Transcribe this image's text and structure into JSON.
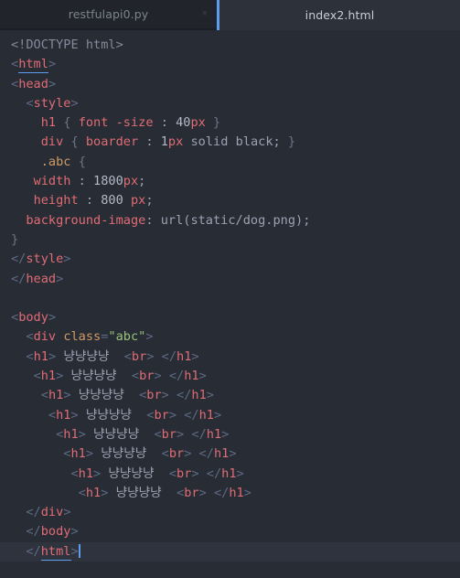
{
  "window": {
    "theme_background": "#282c34",
    "accent_color": "#5c9ded"
  },
  "tabs": [
    {
      "label": "restfulapi0.py",
      "active": false,
      "close_glyph": "×"
    },
    {
      "label": "index2.html",
      "active": true
    }
  ],
  "editor": {
    "language": "html",
    "current_line_index": 31,
    "code_lines": [
      {
        "indent": "",
        "segments": [
          {
            "text": "<!DOCTYPE html>",
            "cls": "dctp"
          }
        ]
      },
      {
        "indent": "",
        "segments": [
          {
            "text": "<",
            "cls": "pnc"
          },
          {
            "text": "html",
            "cls": "tag underline-tag"
          },
          {
            "text": ">",
            "cls": "pnc"
          }
        ]
      },
      {
        "indent": "",
        "segments": [
          {
            "text": "<",
            "cls": "pnc"
          },
          {
            "text": "head",
            "cls": "tag"
          },
          {
            "text": ">",
            "cls": "pnc"
          }
        ]
      },
      {
        "indent": "  ",
        "segments": [
          {
            "text": "<",
            "cls": "pnc"
          },
          {
            "text": "style",
            "cls": "tag"
          },
          {
            "text": ">",
            "cls": "pnc"
          }
        ]
      },
      {
        "indent": "    ",
        "segments": [
          {
            "text": "h1",
            "cls": "tag"
          },
          {
            "text": " ",
            "cls": "txt"
          },
          {
            "text": "{",
            "cls": "brace"
          },
          {
            "text": " ",
            "cls": "txt"
          },
          {
            "text": "font",
            "cls": "tag"
          },
          {
            "text": " ",
            "cls": "txt"
          },
          {
            "text": "-size",
            "cls": "tag"
          },
          {
            "text": " ",
            "cls": "txt"
          },
          {
            "text": ":",
            "cls": "txt"
          },
          {
            "text": " ",
            "cls": "txt"
          },
          {
            "text": "40",
            "cls": "num"
          },
          {
            "text": "px",
            "cls": "unit"
          },
          {
            "text": " ",
            "cls": "txt"
          },
          {
            "text": "}",
            "cls": "brace"
          }
        ]
      },
      {
        "indent": "    ",
        "segments": [
          {
            "text": "div",
            "cls": "tag"
          },
          {
            "text": " ",
            "cls": "txt"
          },
          {
            "text": "{",
            "cls": "brace"
          },
          {
            "text": " ",
            "cls": "txt"
          },
          {
            "text": "boarder",
            "cls": "tag"
          },
          {
            "text": " ",
            "cls": "txt"
          },
          {
            "text": ":",
            "cls": "txt"
          },
          {
            "text": " ",
            "cls": "txt"
          },
          {
            "text": "1",
            "cls": "num"
          },
          {
            "text": "px",
            "cls": "unit"
          },
          {
            "text": " ",
            "cls": "txt"
          },
          {
            "text": "solid",
            "cls": "txt"
          },
          {
            "text": " ",
            "cls": "txt"
          },
          {
            "text": "black",
            "cls": "txt"
          },
          {
            "text": ";",
            "cls": "txt"
          },
          {
            "text": " ",
            "cls": "txt"
          },
          {
            "text": "}",
            "cls": "brace"
          }
        ]
      },
      {
        "indent": "    ",
        "segments": [
          {
            "text": ".abc",
            "cls": "attr"
          },
          {
            "text": " ",
            "cls": "txt"
          },
          {
            "text": "{",
            "cls": "brace"
          }
        ]
      },
      {
        "indent": "   ",
        "segments": [
          {
            "text": "width",
            "cls": "tag"
          },
          {
            "text": " ",
            "cls": "txt"
          },
          {
            "text": ":",
            "cls": "txt"
          },
          {
            "text": " ",
            "cls": "txt"
          },
          {
            "text": "1800",
            "cls": "num"
          },
          {
            "text": "px",
            "cls": "unit"
          },
          {
            "text": ";",
            "cls": "txt"
          }
        ]
      },
      {
        "indent": "   ",
        "segments": [
          {
            "text": "height",
            "cls": "tag"
          },
          {
            "text": " ",
            "cls": "txt"
          },
          {
            "text": ":",
            "cls": "txt"
          },
          {
            "text": " ",
            "cls": "txt"
          },
          {
            "text": "800",
            "cls": "num"
          },
          {
            "text": " ",
            "cls": "txt"
          },
          {
            "text": "px",
            "cls": "unit"
          },
          {
            "text": ";",
            "cls": "txt"
          }
        ]
      },
      {
        "indent": "  ",
        "segments": [
          {
            "text": "background-image",
            "cls": "tag"
          },
          {
            "text": ":",
            "cls": "txt"
          },
          {
            "text": " ",
            "cls": "txt"
          },
          {
            "text": "url(static/dog.png)",
            "cls": "txt"
          },
          {
            "text": ";",
            "cls": "txt"
          }
        ]
      },
      {
        "indent": "",
        "segments": [
          {
            "text": "}",
            "cls": "brace"
          }
        ]
      },
      {
        "indent": "",
        "segments": [
          {
            "text": "</",
            "cls": "pnc"
          },
          {
            "text": "style",
            "cls": "tag"
          },
          {
            "text": ">",
            "cls": "pnc"
          }
        ]
      },
      {
        "indent": "",
        "segments": [
          {
            "text": "</",
            "cls": "pnc"
          },
          {
            "text": "head",
            "cls": "tag"
          },
          {
            "text": ">",
            "cls": "pnc"
          }
        ]
      },
      {
        "indent": "",
        "segments": []
      },
      {
        "indent": "",
        "segments": [
          {
            "text": "<",
            "cls": "pnc"
          },
          {
            "text": "body",
            "cls": "tag"
          },
          {
            "text": ">",
            "cls": "pnc"
          }
        ]
      },
      {
        "indent": "  ",
        "segments": [
          {
            "text": "<",
            "cls": "pnc"
          },
          {
            "text": "div",
            "cls": "tag"
          },
          {
            "text": " ",
            "cls": "txt"
          },
          {
            "text": "class",
            "cls": "attr"
          },
          {
            "text": "=",
            "cls": "pnc"
          },
          {
            "text": "\"abc\"",
            "cls": "str"
          },
          {
            "text": ">",
            "cls": "pnc"
          }
        ]
      },
      {
        "indent": "  ",
        "segments": [
          {
            "text": "<",
            "cls": "pnc"
          },
          {
            "text": "h1",
            "cls": "tag"
          },
          {
            "text": "> ",
            "cls": "pnc"
          },
          {
            "text": "냥냥냥냥",
            "cls": "txt"
          },
          {
            "text": "  ",
            "cls": "txt"
          },
          {
            "text": "<",
            "cls": "pnc"
          },
          {
            "text": "br",
            "cls": "tag"
          },
          {
            "text": "> ",
            "cls": "pnc"
          },
          {
            "text": "</",
            "cls": "pnc"
          },
          {
            "text": "h1",
            "cls": "tag"
          },
          {
            "text": ">",
            "cls": "pnc"
          }
        ]
      },
      {
        "indent": "   ",
        "segments": [
          {
            "text": "<",
            "cls": "pnc"
          },
          {
            "text": "h1",
            "cls": "tag"
          },
          {
            "text": "> ",
            "cls": "pnc"
          },
          {
            "text": "냥냥냥냥",
            "cls": "txt"
          },
          {
            "text": "  ",
            "cls": "txt"
          },
          {
            "text": "<",
            "cls": "pnc"
          },
          {
            "text": "br",
            "cls": "tag"
          },
          {
            "text": "> ",
            "cls": "pnc"
          },
          {
            "text": "</",
            "cls": "pnc"
          },
          {
            "text": "h1",
            "cls": "tag"
          },
          {
            "text": ">",
            "cls": "pnc"
          }
        ]
      },
      {
        "indent": "    ",
        "segments": [
          {
            "text": "<",
            "cls": "pnc"
          },
          {
            "text": "h1",
            "cls": "tag"
          },
          {
            "text": "> ",
            "cls": "pnc"
          },
          {
            "text": "냥냥냥냥",
            "cls": "txt"
          },
          {
            "text": "  ",
            "cls": "txt"
          },
          {
            "text": "<",
            "cls": "pnc"
          },
          {
            "text": "br",
            "cls": "tag"
          },
          {
            "text": "> ",
            "cls": "pnc"
          },
          {
            "text": "</",
            "cls": "pnc"
          },
          {
            "text": "h1",
            "cls": "tag"
          },
          {
            "text": ">",
            "cls": "pnc"
          }
        ]
      },
      {
        "indent": "     ",
        "segments": [
          {
            "text": "<",
            "cls": "pnc"
          },
          {
            "text": "h1",
            "cls": "tag"
          },
          {
            "text": "> ",
            "cls": "pnc"
          },
          {
            "text": "냥냥냥냥",
            "cls": "txt"
          },
          {
            "text": "  ",
            "cls": "txt"
          },
          {
            "text": "<",
            "cls": "pnc"
          },
          {
            "text": "br",
            "cls": "tag"
          },
          {
            "text": "> ",
            "cls": "pnc"
          },
          {
            "text": "</",
            "cls": "pnc"
          },
          {
            "text": "h1",
            "cls": "tag"
          },
          {
            "text": ">",
            "cls": "pnc"
          }
        ]
      },
      {
        "indent": "      ",
        "segments": [
          {
            "text": "<",
            "cls": "pnc"
          },
          {
            "text": "h1",
            "cls": "tag"
          },
          {
            "text": "> ",
            "cls": "pnc"
          },
          {
            "text": "냥냥냥냥",
            "cls": "txt"
          },
          {
            "text": "  ",
            "cls": "txt"
          },
          {
            "text": "<",
            "cls": "pnc"
          },
          {
            "text": "br",
            "cls": "tag"
          },
          {
            "text": "> ",
            "cls": "pnc"
          },
          {
            "text": "</",
            "cls": "pnc"
          },
          {
            "text": "h1",
            "cls": "tag"
          },
          {
            "text": ">",
            "cls": "pnc"
          }
        ]
      },
      {
        "indent": "       ",
        "segments": [
          {
            "text": "<",
            "cls": "pnc"
          },
          {
            "text": "h1",
            "cls": "tag"
          },
          {
            "text": "> ",
            "cls": "pnc"
          },
          {
            "text": "냥냥냥냥",
            "cls": "txt"
          },
          {
            "text": "  ",
            "cls": "txt"
          },
          {
            "text": "<",
            "cls": "pnc"
          },
          {
            "text": "br",
            "cls": "tag"
          },
          {
            "text": "> ",
            "cls": "pnc"
          },
          {
            "text": "</",
            "cls": "pnc"
          },
          {
            "text": "h1",
            "cls": "tag"
          },
          {
            "text": ">",
            "cls": "pnc"
          }
        ]
      },
      {
        "indent": "        ",
        "segments": [
          {
            "text": "<",
            "cls": "pnc"
          },
          {
            "text": "h1",
            "cls": "tag"
          },
          {
            "text": "> ",
            "cls": "pnc"
          },
          {
            "text": "냥냥냥냥",
            "cls": "txt"
          },
          {
            "text": "  ",
            "cls": "txt"
          },
          {
            "text": "<",
            "cls": "pnc"
          },
          {
            "text": "br",
            "cls": "tag"
          },
          {
            "text": "> ",
            "cls": "pnc"
          },
          {
            "text": "</",
            "cls": "pnc"
          },
          {
            "text": "h1",
            "cls": "tag"
          },
          {
            "text": ">",
            "cls": "pnc"
          }
        ]
      },
      {
        "indent": "         ",
        "segments": [
          {
            "text": "<",
            "cls": "pnc"
          },
          {
            "text": "h1",
            "cls": "tag"
          },
          {
            "text": "> ",
            "cls": "pnc"
          },
          {
            "text": "냥냥냥냥",
            "cls": "txt"
          },
          {
            "text": "  ",
            "cls": "txt"
          },
          {
            "text": "<",
            "cls": "pnc"
          },
          {
            "text": "br",
            "cls": "tag"
          },
          {
            "text": "> ",
            "cls": "pnc"
          },
          {
            "text": "</",
            "cls": "pnc"
          },
          {
            "text": "h1",
            "cls": "tag"
          },
          {
            "text": ">",
            "cls": "pnc"
          }
        ]
      },
      {
        "indent": "  ",
        "segments": [
          {
            "text": "</",
            "cls": "pnc"
          },
          {
            "text": "div",
            "cls": "tag"
          },
          {
            "text": ">",
            "cls": "pnc"
          }
        ]
      },
      {
        "indent": "  ",
        "segments": [
          {
            "text": "</",
            "cls": "pnc"
          },
          {
            "text": "body",
            "cls": "tag"
          },
          {
            "text": ">",
            "cls": "pnc"
          }
        ]
      },
      {
        "indent": "  ",
        "current": true,
        "cursor": true,
        "segments": [
          {
            "text": "</",
            "cls": "pnc"
          },
          {
            "text": "html",
            "cls": "tag underline-tag"
          },
          {
            "text": ">",
            "cls": "pnc"
          }
        ]
      }
    ]
  }
}
